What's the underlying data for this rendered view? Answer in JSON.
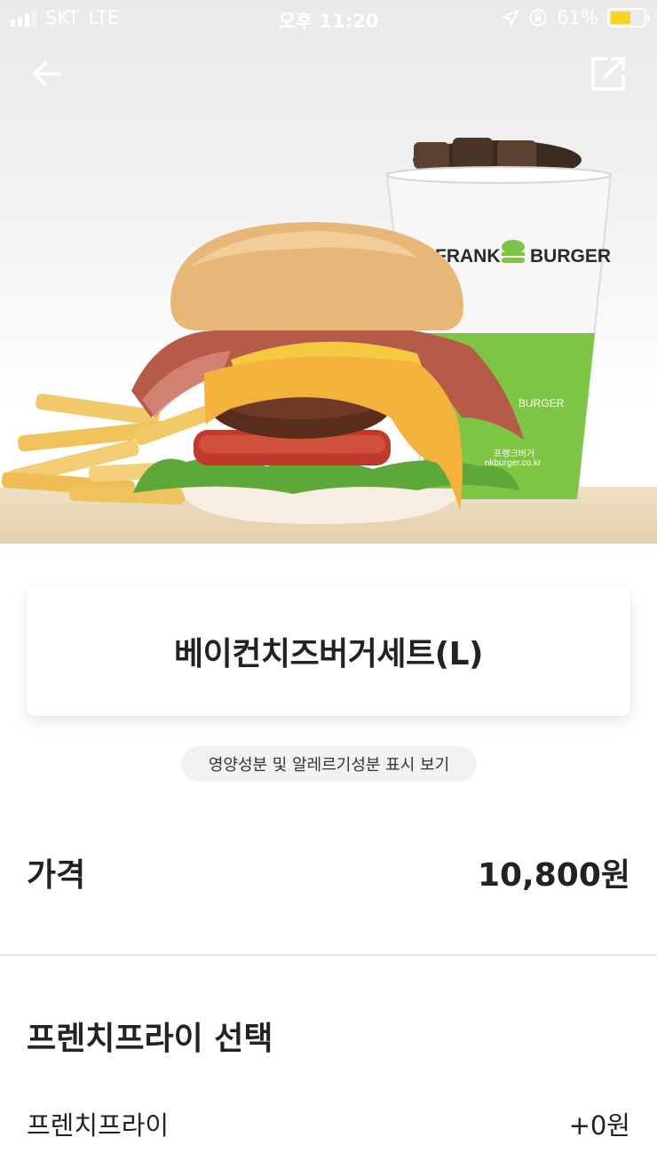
{
  "status_bar": {
    "carrier": "SKT",
    "network": "LTE",
    "time": "오후 11:20",
    "battery_percent": "61%",
    "battery_level": 0.61
  },
  "nav": {
    "back_icon": "arrow-left-icon",
    "share_icon": "share-external-icon"
  },
  "hero": {
    "cup_brand_left": "FRANK",
    "cup_brand_right": "BURGER",
    "cup_small_brand": "BURGER",
    "cup_korean": "프랭크버거",
    "cup_url": "nkburger.co.kr"
  },
  "product": {
    "name": "베이컨치즈버거세트(L)",
    "nutrition_link": "영양성분 및 알레르기성분 표시 보기"
  },
  "price": {
    "label": "가격",
    "value": "10,800원"
  },
  "fries_section": {
    "title": "프렌치프라이 선택",
    "options": [
      {
        "label": "프렌치프라이",
        "price": "+0원"
      }
    ]
  }
}
